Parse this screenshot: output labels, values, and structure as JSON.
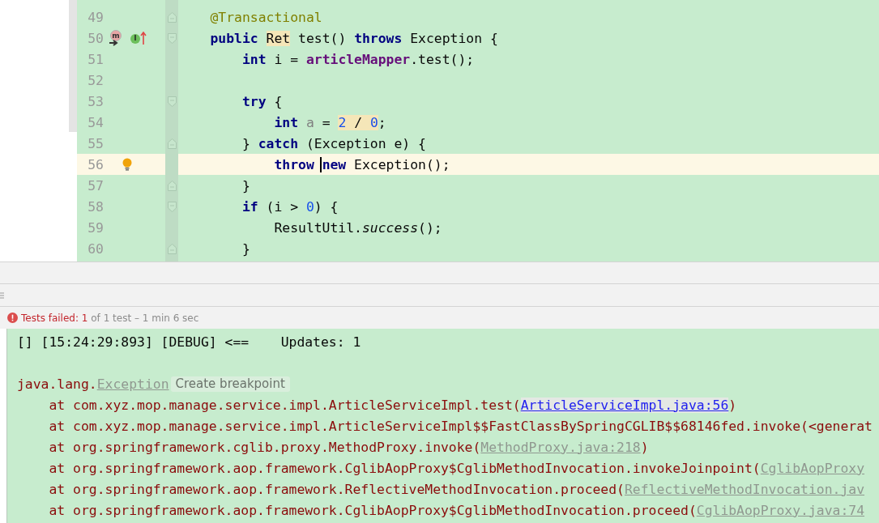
{
  "editor": {
    "lines": [
      {
        "number": "49",
        "highlighted": false,
        "fold": {
          "kind": "end"
        },
        "tokens": [
          {
            "kind": "annotation",
            "text": "    @Transactional"
          }
        ]
      },
      {
        "number": "50",
        "highlighted": false,
        "fold": {
          "kind": "start"
        },
        "markers": [
          {
            "kind": "method",
            "label": "m"
          },
          {
            "kind": "implements",
            "label": "I"
          }
        ],
        "tokens": [
          {
            "kind": "keyword",
            "text": "    public "
          },
          {
            "kind": "plain",
            "text": "Ret",
            "highlighted": true
          },
          {
            "kind": "plain",
            "text": " test() "
          },
          {
            "kind": "keyword",
            "text": "throws"
          },
          {
            "kind": "plain",
            "text": " Exception {"
          }
        ]
      },
      {
        "number": "51",
        "highlighted": false,
        "tokens": [
          {
            "kind": "keyword",
            "text": "        int"
          },
          {
            "kind": "plain",
            "text": " i = "
          },
          {
            "kind": "field",
            "text": "articleMapper"
          },
          {
            "kind": "plain",
            "text": ".test();"
          }
        ]
      },
      {
        "number": "52",
        "highlighted": false
      },
      {
        "number": "53",
        "highlighted": false,
        "fold": {
          "kind": "start"
        },
        "tokens": [
          {
            "kind": "keyword",
            "text": "        try"
          },
          {
            "kind": "plain",
            "text": " {"
          }
        ]
      },
      {
        "number": "54",
        "highlighted": false,
        "tokens": [
          {
            "kind": "keyword",
            "text": "            int "
          },
          {
            "kind": "unused",
            "text": "a"
          },
          {
            "kind": "plain",
            "text": " = "
          },
          {
            "kind": "number",
            "text": "2 ",
            "highlighted": true
          },
          {
            "kind": "plain",
            "text": "/ ",
            "highlighted": true
          },
          {
            "kind": "number",
            "text": "0",
            "highlighted": true
          },
          {
            "kind": "plain",
            "text": ";"
          }
        ]
      },
      {
        "number": "55",
        "highlighted": false,
        "fold": {
          "kind": "end"
        },
        "tokens": [
          {
            "kind": "plain",
            "text": "        } "
          },
          {
            "kind": "keyword",
            "text": "catch"
          },
          {
            "kind": "plain",
            "text": " (Exception e) {"
          }
        ]
      },
      {
        "number": "56",
        "highlighted": true,
        "markers": [
          {
            "kind": "bulb"
          }
        ],
        "tokens": [
          {
            "kind": "keyword",
            "text": "            throw "
          },
          {
            "kind": "keyword",
            "text": "new",
            "caret": true
          },
          {
            "kind": "plain",
            "text": " Exception();"
          }
        ]
      },
      {
        "number": "57",
        "highlighted": false,
        "fold": {
          "kind": "end"
        },
        "tokens": [
          {
            "kind": "plain",
            "text": "        }"
          }
        ]
      },
      {
        "number": "58",
        "highlighted": false,
        "fold": {
          "kind": "start"
        },
        "tokens": [
          {
            "kind": "keyword",
            "text": "        if"
          },
          {
            "kind": "plain",
            "text": " (i > "
          },
          {
            "kind": "number",
            "text": "0"
          },
          {
            "kind": "plain",
            "text": ") {"
          }
        ]
      },
      {
        "number": "59",
        "highlighted": false,
        "tokens": [
          {
            "kind": "plain",
            "text": "            ResultUtil."
          },
          {
            "kind": "static",
            "text": "success"
          },
          {
            "kind": "plain",
            "text": "();"
          }
        ]
      },
      {
        "number": "60",
        "highlighted": false,
        "fold": {
          "kind": "end"
        },
        "tokens": [
          {
            "kind": "plain",
            "text": "        }"
          }
        ]
      }
    ]
  },
  "test_status": {
    "segments": [
      {
        "kind": "failed",
        "text": "Tests failed: "
      },
      {
        "kind": "failed",
        "text": "1"
      },
      {
        "kind": "info",
        "text": " of 1 test – 1 min 6 sec"
      }
    ]
  },
  "console": {
    "lines": [
      {
        "kind": "text",
        "segments": [
          {
            "kind": "plain",
            "text": "[] [15:24:29:893] [DEBUG] <==    Updates: 1"
          }
        ]
      },
      {
        "kind": "blank"
      },
      {
        "kind": "text",
        "segments": [
          {
            "kind": "error",
            "text": "java.lang."
          },
          {
            "kind": "dim_link",
            "text": "Exception"
          }
        ],
        "tooltip": "Create breakpoint"
      },
      {
        "kind": "text",
        "segments": [
          {
            "kind": "error",
            "text": "    at com.xyz.mop.manage.service.impl.ArticleServiceImpl.test("
          },
          {
            "kind": "link",
            "text": "ArticleServiceImpl.java:56"
          },
          {
            "kind": "error",
            "text": ")"
          }
        ]
      },
      {
        "kind": "text",
        "segments": [
          {
            "kind": "error",
            "text": "    at com.xyz.mop.manage.service.impl.ArticleServiceImpl$$FastClassBySpringCGLIB$$68146fed.invoke(<generat"
          }
        ]
      },
      {
        "kind": "text",
        "segments": [
          {
            "kind": "error",
            "text": "    at org.springframework.cglib.proxy.MethodProxy.invoke("
          },
          {
            "kind": "dim_link",
            "text": "MethodProxy.java:218"
          },
          {
            "kind": "error",
            "text": ")"
          }
        ]
      },
      {
        "kind": "text",
        "segments": [
          {
            "kind": "error",
            "text": "    at org.springframework.aop.framework.CglibAopProxy$CglibMethodInvocation.invokeJoinpoint("
          },
          {
            "kind": "dim_link",
            "text": "CglibAopProxy"
          }
        ]
      },
      {
        "kind": "text",
        "segments": [
          {
            "kind": "error",
            "text": "    at org.springframework.aop.framework.ReflectiveMethodInvocation.proceed("
          },
          {
            "kind": "dim_link",
            "text": "ReflectiveMethodInvocation.jav"
          }
        ]
      },
      {
        "kind": "text",
        "segments": [
          {
            "kind": "error",
            "text": "    at org.springframework.aop.framework.CglibAopProxy$CglibMethodInvocation.proceed("
          },
          {
            "kind": "dim_link",
            "text": "CglibAopProxy.java:74"
          }
        ]
      }
    ]
  }
}
